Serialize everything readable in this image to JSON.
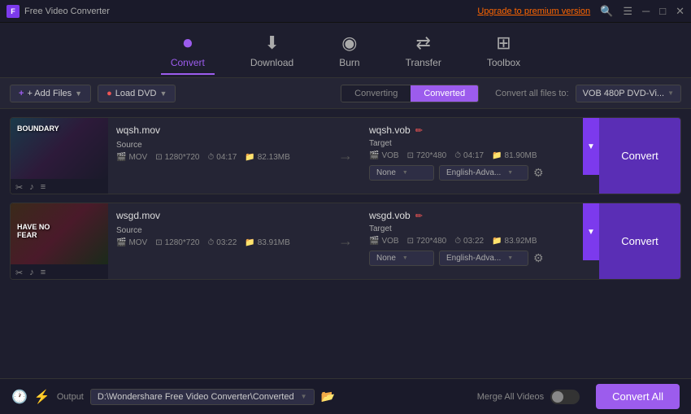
{
  "app": {
    "title": "Free Video Converter",
    "upgrade_text": "Upgrade to premium version"
  },
  "toolbar": {
    "items": [
      {
        "id": "convert",
        "label": "Convert",
        "icon": "⏺",
        "active": true
      },
      {
        "id": "download",
        "label": "Download",
        "icon": "⬇",
        "active": false
      },
      {
        "id": "burn",
        "label": "Burn",
        "icon": "◉",
        "active": false
      },
      {
        "id": "transfer",
        "label": "Transfer",
        "icon": "⇄",
        "active": false
      },
      {
        "id": "toolbox",
        "label": "Toolbox",
        "icon": "⊞",
        "active": false
      }
    ]
  },
  "actionbar": {
    "add_files_label": "+ Add Files",
    "load_dvd_label": "● Load DVD",
    "tab_converting": "Converting",
    "tab_converted": "Converted",
    "convert_all_files_label": "Convert all files to:",
    "format_value": "VOB 480P DVD-Vi..."
  },
  "files": [
    {
      "id": "file1",
      "source_filename": "wqsh.mov",
      "target_filename": "wqsh.vob",
      "source": {
        "format": "MOV",
        "resolution": "1280*720",
        "duration": "04:17",
        "size": "82.13MB"
      },
      "target": {
        "format": "VOB",
        "resolution": "720*480",
        "duration": "04:17",
        "size": "81.90MB"
      },
      "quality_option": "None",
      "language_option": "English-Adva...",
      "thumb_label": "BOUNDARY",
      "thumb_variant": 1
    },
    {
      "id": "file2",
      "source_filename": "wsgd.mov",
      "target_filename": "wsgd.vob",
      "source": {
        "format": "MOV",
        "resolution": "1280*720",
        "duration": "03:22",
        "size": "83.91MB"
      },
      "target": {
        "format": "VOB",
        "resolution": "720*480",
        "duration": "03:22",
        "size": "83.92MB"
      },
      "quality_option": "None",
      "language_option": "English-Adva...",
      "thumb_label": "FEAR",
      "thumb_variant": 2
    }
  ],
  "bottombar": {
    "output_label": "Output",
    "output_path": "D:\\Wondershare Free Video Converter\\Converted",
    "merge_label": "Merge All Videos",
    "convert_all_btn": "Convert All"
  },
  "buttons": {
    "convert_label": "Convert",
    "source_label": "Source",
    "target_label": "Target"
  }
}
